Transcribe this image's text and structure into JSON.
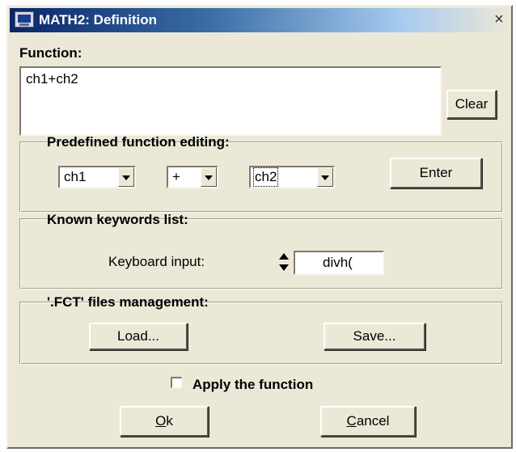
{
  "window": {
    "title": "MATH2: Definition",
    "close_glyph": "×"
  },
  "function": {
    "label": "Function:",
    "value": "ch1+ch2",
    "clear_label": "Clear"
  },
  "predefined": {
    "title": "Predefined function editing:",
    "operand1": "ch1",
    "operator": "+",
    "operand2": "ch2",
    "enter_label": "Enter"
  },
  "keywords": {
    "title": "Known keywords list:",
    "input_label": "Keyboard input:",
    "input_value": "divh("
  },
  "files": {
    "title": "'.FCT' files management:",
    "load_label": "Load...",
    "save_label": "Save..."
  },
  "apply": {
    "label": "Apply the function",
    "checked": false
  },
  "footer": {
    "ok_accel": "O",
    "ok_rest": "k",
    "cancel_accel": "C",
    "cancel_rest": "ancel"
  },
  "colors": {
    "titlebar_start": "#0a246a",
    "dialog_bg": "#ece8d7"
  },
  "icons": {
    "app": "app-icon",
    "close": "close-icon",
    "spinner": "spinner-icon",
    "dropdown": "chevron-down-icon"
  }
}
